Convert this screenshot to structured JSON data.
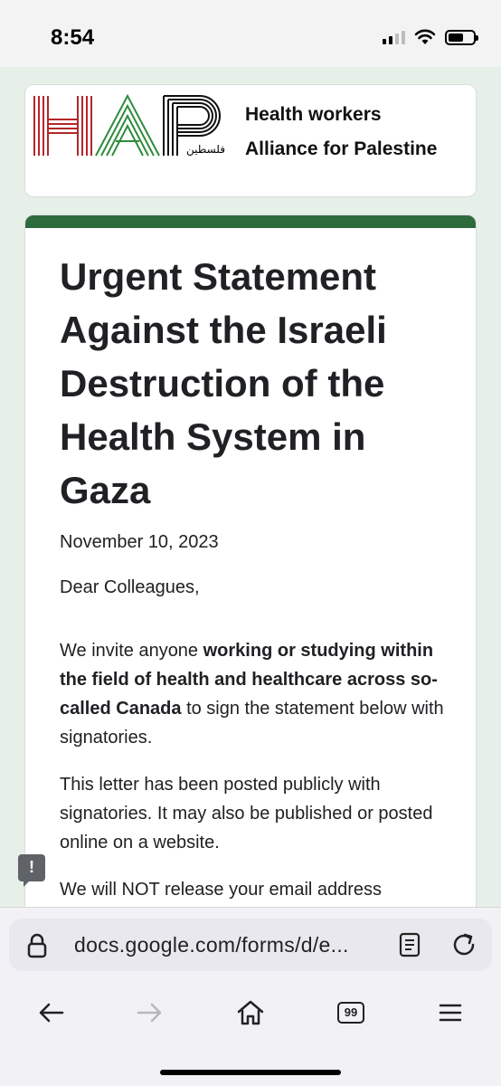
{
  "status": {
    "time": "8:54"
  },
  "header": {
    "logo_letters": "HAP",
    "logo_arabic": "فلسطين",
    "org_line1": "Health workers",
    "org_line2": "Alliance for Palestine"
  },
  "form": {
    "title": "Urgent Statement Against the Israeli Destruction of the Health System in Gaza",
    "date": "November 10, 2023",
    "greeting": "Dear Colleagues,",
    "para1_pre": "We invite anyone ",
    "para1_bold": "working or studying within the field of health and healthcare across so-called Canada",
    "para1_post": " to sign the statement below with signatories.",
    "para2": "This letter has been posted publicly with signatories. It may also be published or posted online on a website.",
    "para3_partial": "We will NOT release your email address"
  },
  "browser": {
    "url": "docs.google.com/forms/d/e...",
    "tabs_count": "99"
  },
  "colors": {
    "accent_green": "#2e6b3c",
    "logo_red": "#b3262a",
    "logo_green": "#2e8b3c",
    "background": "#e7f0e8"
  },
  "icons": {
    "feedback": "feedback-icon",
    "lock": "lock-icon",
    "reader": "reader-mode-icon",
    "reload": "reload-icon",
    "back": "back-arrow-icon",
    "forward": "forward-arrow-icon",
    "home": "home-icon",
    "tabs": "tabs-icon",
    "menu": "menu-icon"
  }
}
